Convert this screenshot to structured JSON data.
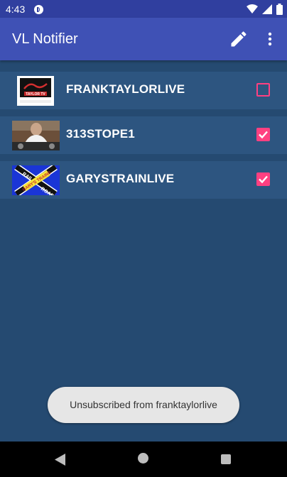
{
  "status_bar": {
    "time": "4:43",
    "app_icon": "pocket-cast-icon",
    "wifi_icon": "wifi-icon",
    "signal_icon": "cell-signal-icon",
    "battery_icon": "battery-icon"
  },
  "app_bar": {
    "title": "VL Notifier",
    "edit_icon": "edit-pencil-icon",
    "more_icon": "more-vert-icon"
  },
  "subscriptions": [
    {
      "name": "FRANKTAYLORLIVE",
      "subscribed": false,
      "thumb_text": "TAYLOR TV",
      "thumb_url_text": "FRANKTAYLORLIVE"
    },
    {
      "name": "313STOPE1",
      "subscribed": true
    },
    {
      "name": "GARYSTRAINLIVE",
      "subscribed": true,
      "thumb_text_top": "RAIL",
      "thumb_text_bottom": "ROAD",
      "thumb_text_center": "GARY'S TRAINS"
    }
  ],
  "toast": {
    "message": "Unsubscribed from franktaylorlive"
  },
  "nav_bar": {
    "back_icon": "nav-back-icon",
    "home_icon": "nav-home-icon",
    "recents_icon": "nav-recents-icon"
  },
  "colors": {
    "primary": "#3f51b5",
    "primary_dark": "#303f9f",
    "accent": "#ff4081",
    "background": "#254a71",
    "row": "#2d5580"
  }
}
